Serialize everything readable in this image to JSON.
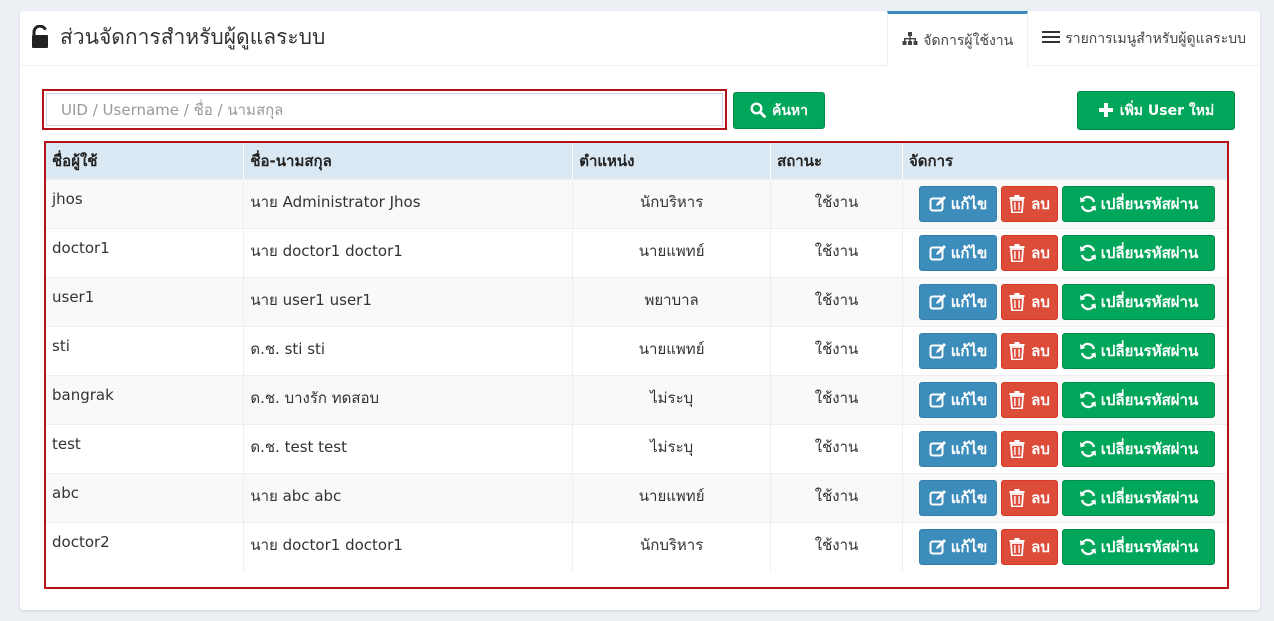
{
  "header": {
    "title": "ส่วนจัดการสำหรับผู้ดูแลระบบ",
    "tabs": [
      {
        "label": "จัดการผู้ใช้งาน",
        "icon": "sitemap-icon",
        "active": true
      },
      {
        "label": "รายการเมนูสำหรับผู้ดูแลระบบ",
        "icon": "list-icon",
        "active": false
      }
    ]
  },
  "search": {
    "placeholder": "UID / Username / ชื่อ / นามสกุล",
    "value": "",
    "button_label": "ค้นหา"
  },
  "add_button_label": "เพิ่ม User ใหม่",
  "table": {
    "columns": [
      "ชื่อผู้ใช้",
      "ชื่อ-นามสกุล",
      "ตำแหน่ง",
      "สถานะ",
      "จัดการ"
    ],
    "action_labels": {
      "edit": "แก้ไข",
      "delete": "ลบ",
      "change_password": "เปลี่ยนรหัสผ่าน"
    },
    "rows": [
      {
        "username": "jhos",
        "fullname": "นาย Administrator Jhos",
        "position": "นักบริหาร",
        "status": "ใช้งาน"
      },
      {
        "username": "doctor1",
        "fullname": "นาย doctor1 doctor1",
        "position": "นายแพทย์",
        "status": "ใช้งาน"
      },
      {
        "username": "user1",
        "fullname": "นาย user1 user1",
        "position": "พยาบาล",
        "status": "ใช้งาน"
      },
      {
        "username": "sti",
        "fullname": "ด.ช. sti sti",
        "position": "นายแพทย์",
        "status": "ใช้งาน"
      },
      {
        "username": "bangrak",
        "fullname": "ด.ช. บางรัก ทดสอบ",
        "position": "ไม่ระบุ",
        "status": "ใช้งาน"
      },
      {
        "username": "test",
        "fullname": "ด.ช. test test",
        "position": "ไม่ระบุ",
        "status": "ใช้งาน"
      },
      {
        "username": "abc",
        "fullname": "นาย abc abc",
        "position": "นายแพทย์",
        "status": "ใช้งาน"
      },
      {
        "username": "doctor2",
        "fullname": "นาย doctor1 doctor1",
        "position": "นักบริหาร",
        "status": "ใช้งาน"
      }
    ]
  },
  "colors": {
    "primary": "#3c8dbc",
    "success": "#00a65a",
    "danger": "#dd4b39",
    "highlight_border": "#b5131a",
    "table_header_bg": "#d9e8f3"
  }
}
